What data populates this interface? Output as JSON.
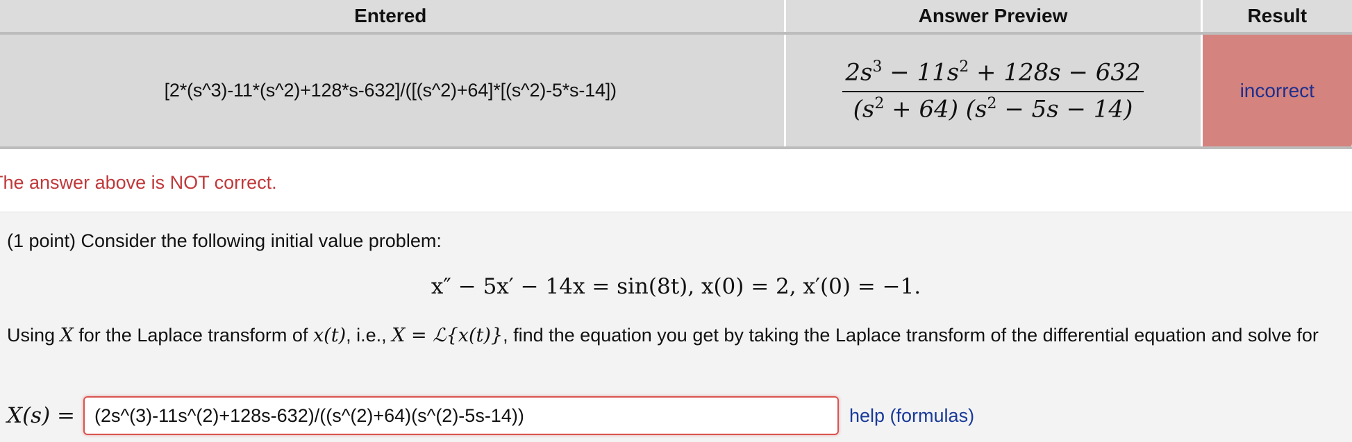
{
  "table": {
    "headers": {
      "entered": "Entered",
      "preview": "Answer Preview",
      "result": "Result"
    },
    "row": {
      "entered": "[2*(s^3)-11*(s^2)+128*s-632]/([(s^2)+64]*[(s^2)-5*s-14])",
      "preview_numerator": {
        "a": "2s",
        "a_exp": "3",
        "b": " − 11s",
        "b_exp": "2",
        "c": " + 128s − 632"
      },
      "preview_denominator": {
        "a": "(s",
        "a_exp": "2",
        "b": " + 64) (s",
        "b_exp": "2",
        "c": " − 5s − 14)"
      },
      "result": "incorrect"
    }
  },
  "message": "The answer above is NOT correct.",
  "problem": {
    "intro": "(1 point) Consider the following initial value problem:",
    "equation": "x″ − 5x′ − 14x = sin(8t),     x(0) = 2,     x′(0) = −1.",
    "using": {
      "p1": "Using ",
      "X1": "X",
      "p2": " for the Laplace transform of ",
      "xt": "x(t)",
      "p3": ", i.e., ",
      "Xeq": "X = ℒ{x(t)}",
      "p4": ", find the equation you get by taking the Laplace transform of the differential equation and solve for"
    },
    "answer_label": "X(s) =",
    "answer_value": "(2s^(3)-11s^(2)+128s-632)/((s^(2)+64)(s^(2)-5s-14))",
    "help_link": "help (formulas)"
  },
  "colors": {
    "incorrect_cell": "#d4837f",
    "message": "#c0393b",
    "link": "#1a3a9a",
    "input_border": "#d9534f"
  }
}
